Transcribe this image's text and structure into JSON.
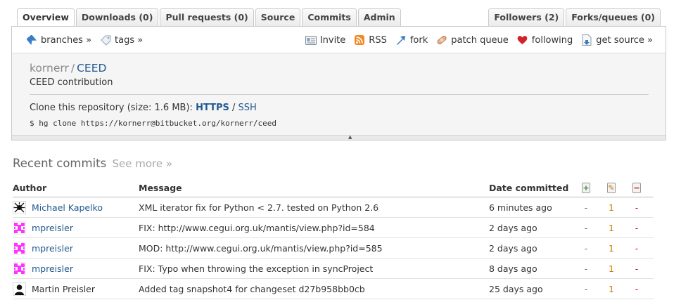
{
  "tabs": {
    "left": [
      {
        "label": "Overview",
        "active": true
      },
      {
        "label": "Downloads (0)"
      },
      {
        "label": "Pull requests (0)"
      },
      {
        "label": "Source"
      },
      {
        "label": "Commits"
      },
      {
        "label": "Admin"
      }
    ],
    "right": [
      {
        "label": "Followers (2)"
      },
      {
        "label": "Forks/queues (0)"
      }
    ]
  },
  "toolbar": {
    "branches": "branches »",
    "tags": "tags »",
    "invite": "Invite",
    "rss": "RSS",
    "fork": "fork",
    "patch_queue": "patch queue",
    "following": "following",
    "get_source": "get source »"
  },
  "repo": {
    "owner": "kornerr",
    "separator": "/",
    "name": "CEED",
    "description": "CEED contribution",
    "clone_prefix": "Clone this repository (size: 1.6 MB):",
    "clone_https": "HTTPS",
    "clone_sep": "/",
    "clone_ssh": "SSH",
    "clone_command": "$ hg clone https://kornerr@bitbucket.org/kornerr/ceed"
  },
  "recent": {
    "title": "Recent commits",
    "see_more": "See more »"
  },
  "table": {
    "headers": {
      "author": "Author",
      "message": "Message",
      "date": "Date committed"
    },
    "header_icons": {
      "added": "+",
      "modified": "✎",
      "removed": "−"
    },
    "rows": [
      {
        "author": "Michael Kapelko",
        "avatar": "spider-avatar",
        "message": "XML iterator fix for Python < 2.7. tested on Python 2.6",
        "date": "6 minutes ago",
        "added": "-",
        "modified": "1",
        "removed": "-"
      },
      {
        "author": "mpreisler",
        "avatar": "identicon-avatar",
        "message": "FIX: http://www.cegui.org.uk/mantis/view.php?id=584",
        "date": "2 days ago",
        "added": "-",
        "modified": "1",
        "removed": "-"
      },
      {
        "author": "mpreisler",
        "avatar": "identicon-avatar",
        "message": "MOD: http://www.cegui.org.uk/mantis/view.php?id=585",
        "date": "2 days ago",
        "added": "-",
        "modified": "1",
        "removed": "-"
      },
      {
        "author": "mpreisler",
        "avatar": "identicon-avatar",
        "message": "FIX: Typo when throwing the exception in syncProject",
        "date": "8 days ago",
        "added": "-",
        "modified": "1",
        "removed": "-"
      },
      {
        "author": "Martin Preisler",
        "avatar": "silhouette-avatar",
        "message": "Added tag snapshot4 for changeset d27b958bb0cb",
        "date": "25 days ago",
        "added": "-",
        "modified": "1",
        "removed": "-"
      }
    ]
  },
  "colors": {
    "link": "#225a8f",
    "added": "#3a8a3a",
    "modified": "#c87f00",
    "removed": "#cc0000",
    "identicon": "#ff33ff"
  }
}
